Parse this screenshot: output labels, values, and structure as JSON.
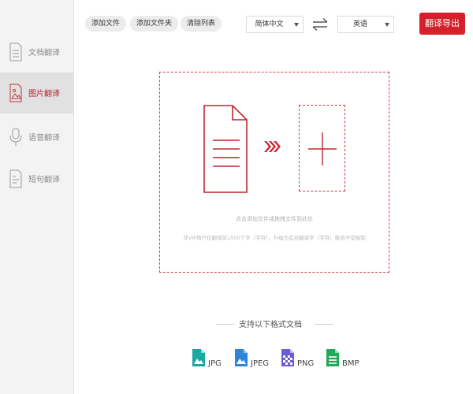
{
  "sidebar": {
    "items": [
      {
        "label": "文档翻译",
        "icon": "document-icon",
        "active": false
      },
      {
        "label": "图片翻译",
        "icon": "image-icon",
        "active": true
      },
      {
        "label": "语音翻译",
        "icon": "microphone-icon",
        "active": false
      },
      {
        "label": "短句翻译",
        "icon": "short-text-icon",
        "active": false
      }
    ]
  },
  "toolbar": {
    "add_file": "添加文件",
    "add_folder": "添加文件夹",
    "clear_list": "清除列表",
    "source_language": "简体中文",
    "target_language": "英语",
    "swap_icon": "swap-arrows-icon",
    "export_label": "翻译导出"
  },
  "dropzone": {
    "hint_primary": "点击添加文件或拖拽文件到此处",
    "hint_secondary": "非VIP用户仅翻译前1500个字（字符），升级为会员翻译字（字符）数将不受限制",
    "doc_icon": "document-icon",
    "arrow_icon": "triple-arrow-right-icon",
    "add_icon": "plus-icon"
  },
  "formats": {
    "title": "支持以下格式文档",
    "items": [
      {
        "label": "JPG",
        "color": "#1aa8a0"
      },
      {
        "label": "JPEG",
        "color": "#2f86d8"
      },
      {
        "label": "PNG",
        "color": "#6a5bd6"
      },
      {
        "label": "BMP",
        "color": "#22a85a"
      }
    ]
  },
  "colors": {
    "accent": "#d3202b",
    "active_text": "#b3232b",
    "sidebar_bg": "#f3f3f3"
  }
}
